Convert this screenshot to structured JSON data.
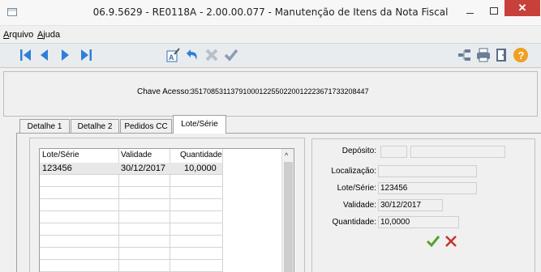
{
  "window": {
    "title": "06.9.5629 - RE0118A - 2.00.00.077 - Manutenção de Itens da Nota Fiscal",
    "close_glyph": "✕"
  },
  "menu": {
    "items": [
      {
        "label": "Arquivo"
      },
      {
        "label": "Ajuda"
      }
    ]
  },
  "toolbar": {
    "left_icons": [
      "first-record-icon",
      "previous-record-icon",
      "next-record-icon",
      "last-record-icon"
    ],
    "middle_icons": [
      "edit-icon",
      "undo-icon",
      "delete-icon",
      "confirm-icon"
    ],
    "right_icons": [
      "flow-icon",
      "print-icon",
      "exit-icon",
      "help-icon"
    ]
  },
  "header": {
    "chave_label": "Chave Acesso:",
    "chave_value": "35170853113791000122550220012223671733208447"
  },
  "tabs": [
    {
      "label": "Detalhe 1",
      "active": false
    },
    {
      "label": "Detalhe 2",
      "active": false
    },
    {
      "label": "Pedidos CC",
      "active": false
    },
    {
      "label": "Lote/Série",
      "active": true
    }
  ],
  "grid": {
    "columns": [
      "Lote/Série",
      "Validade",
      "Quantidade"
    ],
    "rows": [
      {
        "lote": "123456",
        "validade": "30/12/2017",
        "quantidade": "10,0000"
      }
    ],
    "scroll_up_glyph": "^"
  },
  "details": {
    "deposito_label": "Depósito:",
    "localizacao_label": "Localização:",
    "lote_label": "Lote/Série:",
    "lote_value": "123456",
    "validade_label": "Validade:",
    "validade_value": "30/12/2017",
    "quantidade_label": "Quantidade:",
    "quantidade_value": "10,0000"
  },
  "colors": {
    "close_button": "#c7413a",
    "nav_blue": "#2f7fd8",
    "ok_green": "#5aa02c",
    "cancel_red": "#c8312b",
    "help_orange": "#f0a020"
  }
}
